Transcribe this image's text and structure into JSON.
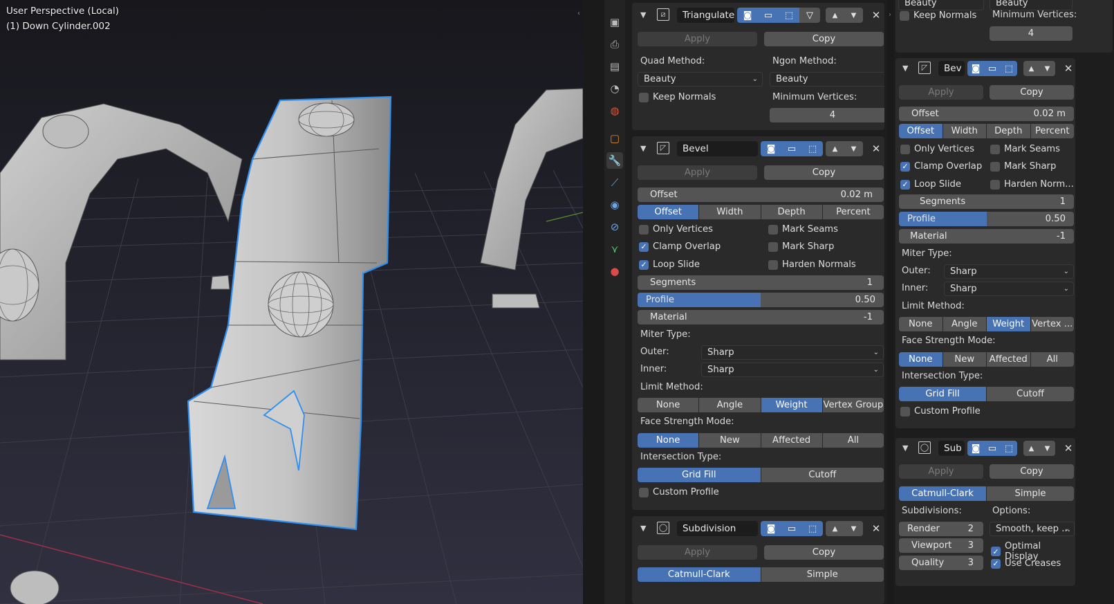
{
  "viewport": {
    "perspective_label": "User Perspective (Local)",
    "object_label": "(1) Down Cylinder.002"
  },
  "sidebar": {
    "tabs": [
      "render-icon",
      "output-icon",
      "view-layer-icon",
      "scene-icon",
      "world-icon",
      "object-icon",
      "modifier-icon",
      "particles-icon",
      "physics-icon",
      "constraints-icon",
      "data-icon",
      "material-icon"
    ],
    "active": "modifier-icon"
  },
  "left": {
    "triangulate": {
      "name": "Triangulate",
      "apply": "Apply",
      "copy": "Copy",
      "quad_label": "Quad Method:",
      "quad_value": "Beauty",
      "ngon_label": "Ngon Method:",
      "ngon_value": "Beauty",
      "keep_normals": "Keep Normals",
      "min_vertices_label": "Minimum Vertices:",
      "min_vertices_value": "4"
    },
    "bevel": {
      "name": "Bevel",
      "apply": "Apply",
      "copy": "Copy",
      "offset_label": "Offset",
      "offset_value": "0.02 m",
      "width_type": [
        "Offset",
        "Width",
        "Depth",
        "Percent"
      ],
      "only_vertices": "Only Vertices",
      "mark_seams": "Mark Seams",
      "clamp_overlap": "Clamp Overlap",
      "mark_sharp": "Mark Sharp",
      "loop_slide": "Loop Slide",
      "harden_normals": "Harden Normals",
      "segments_label": "Segments",
      "segments_value": "1",
      "profile_label": "Profile",
      "profile_value": "0.50",
      "profile_fraction": 0.5,
      "material_label": "Material",
      "material_value": "-1",
      "miter_label": "Miter Type:",
      "outer_label": "Outer:",
      "outer_value": "Sharp",
      "inner_label": "Inner:",
      "inner_value": "Sharp",
      "limit_label": "Limit Method:",
      "limit_options": [
        "None",
        "Angle",
        "Weight",
        "Vertex Group"
      ],
      "face_strength_label": "Face Strength Mode:",
      "face_strength_options": [
        "None",
        "New",
        "Affected",
        "All"
      ],
      "intersection_label": "Intersection Type:",
      "intersection_options": [
        "Grid Fill",
        "Cutoff"
      ],
      "custom_profile": "Custom Profile"
    },
    "subdivision": {
      "name": "Subdivision",
      "apply": "Apply",
      "copy": "Copy",
      "types": [
        "Catmull-Clark",
        "Simple"
      ]
    }
  },
  "right": {
    "top": {
      "quad_value": "Beauty",
      "ngon_value": "Beauty",
      "keep_normals": "Keep Normals",
      "min_vertices_label": "Minimum Vertices:",
      "min_vertices_value": "4"
    },
    "bevel": {
      "name": "Bev",
      "apply": "Apply",
      "copy": "Copy",
      "offset_label": "Offset",
      "offset_value": "0.02 m",
      "width_type": [
        "Offset",
        "Width",
        "Depth",
        "Percent"
      ],
      "only_vertices": "Only Vertices",
      "mark_seams": "Mark Seams",
      "clamp_overlap": "Clamp Overlap",
      "mark_sharp": "Mark Sharp",
      "loop_slide": "Loop Slide",
      "harden_normals": "Harden Norm...",
      "segments_label": "Segments",
      "segments_value": "1",
      "profile_label": "Profile",
      "profile_value": "0.50",
      "material_label": "Material",
      "material_value": "-1",
      "miter_label": "Miter Type:",
      "outer_label": "Outer:",
      "outer_value": "Sharp",
      "inner_label": "Inner:",
      "inner_value": "Sharp",
      "limit_label": "Limit Method:",
      "limit_options": [
        "None",
        "Angle",
        "Weight",
        "Vertex ..."
      ],
      "face_strength_label": "Face Strength Mode:",
      "face_strength_options": [
        "None",
        "New",
        "Affected",
        "All"
      ],
      "intersection_label": "Intersection Type:",
      "intersection_options": [
        "Grid Fill",
        "Cutoff"
      ],
      "custom_profile": "Custom Profile"
    },
    "subdivision": {
      "name": "Sub",
      "apply": "Apply",
      "copy": "Copy",
      "types": [
        "Catmull-Clark",
        "Simple"
      ],
      "subdivisions_label": "Subdivisions:",
      "render_label": "Render",
      "render_value": "2",
      "viewport_label": "Viewport",
      "viewport_value": "3",
      "quality_label": "Quality",
      "quality_value": "3",
      "options_label": "Options:",
      "options_value": "Smooth, keep ...",
      "optimal_display": "Optimal Display",
      "use_creases": "Use Creases"
    }
  },
  "colors": {
    "accent": "#4772b3",
    "selection_outline": "#2f8ff0"
  }
}
